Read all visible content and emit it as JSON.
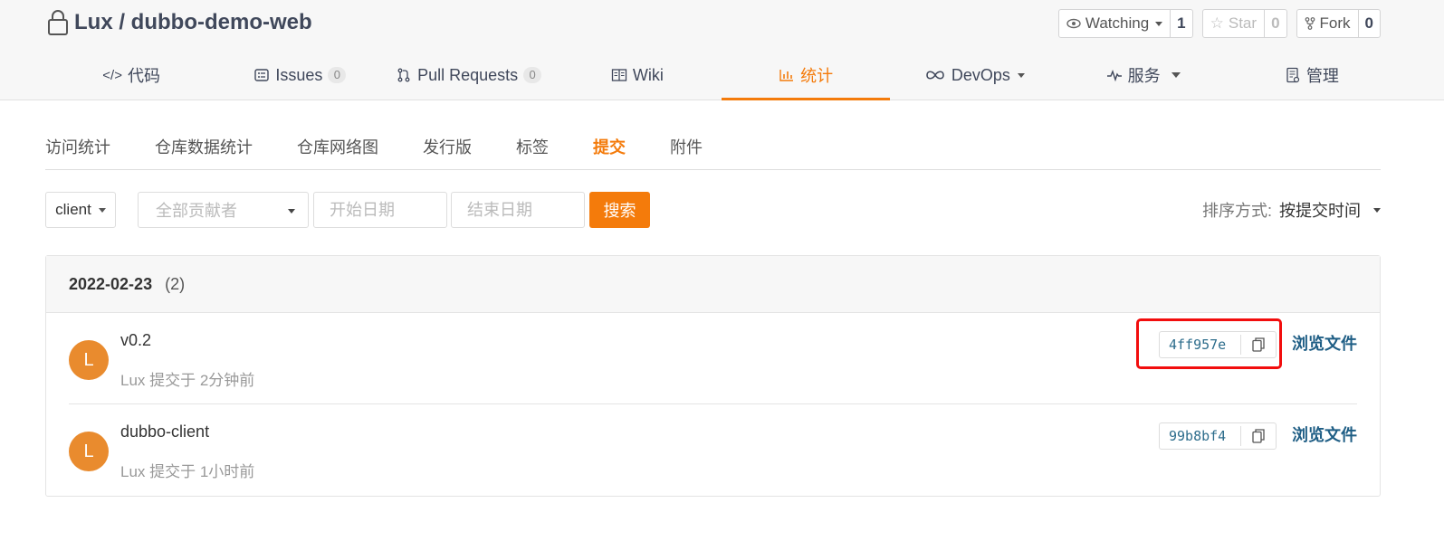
{
  "repo": {
    "title": "Lux / dubbo-demo-web"
  },
  "actions": {
    "watch": {
      "label": "Watching",
      "count": "1"
    },
    "star": {
      "label": "Star",
      "count": "0"
    },
    "fork": {
      "label": "Fork",
      "count": "0"
    }
  },
  "tabs": [
    {
      "label": "代码",
      "icon": "code-icon"
    },
    {
      "label": "Issues",
      "badge": "0",
      "icon": "issues-icon"
    },
    {
      "label": "Pull Requests",
      "badge": "0",
      "icon": "pull-request-icon"
    },
    {
      "label": "Wiki",
      "icon": "wiki-icon"
    },
    {
      "label": "统计",
      "icon": "chart-icon",
      "active": true
    },
    {
      "label": "DevOps",
      "icon": "infinity-icon"
    },
    {
      "label": "服务",
      "icon": "pulse-icon"
    },
    {
      "label": "管理",
      "icon": "settings-doc-icon"
    }
  ],
  "subnav": [
    "访问统计",
    "仓库数据统计",
    "仓库网络图",
    "发行版",
    "标签",
    "提交",
    "附件"
  ],
  "filters": {
    "branch": "client",
    "author_placeholder": "全部贡献者",
    "start_placeholder": "开始日期",
    "end_placeholder": "结束日期",
    "search_label": "搜索",
    "sort_label": "排序方式:",
    "sort_value": "按提交时间"
  },
  "commit_group": {
    "date": "2022-02-23",
    "count": "(2)",
    "commits": [
      {
        "avatar": "L",
        "message": "v0.2",
        "meta": "Lux 提交于 2分钟前",
        "sha": "4ff957e",
        "browse": "浏览文件"
      },
      {
        "avatar": "L",
        "message": "dubbo-client",
        "meta": "Lux 提交于 1小时前",
        "sha": "99b8bf4",
        "browse": "浏览文件"
      }
    ]
  },
  "colors": {
    "accent": "#f47b0b",
    "link": "#1f5e85",
    "highlight": "#f20d0d"
  }
}
